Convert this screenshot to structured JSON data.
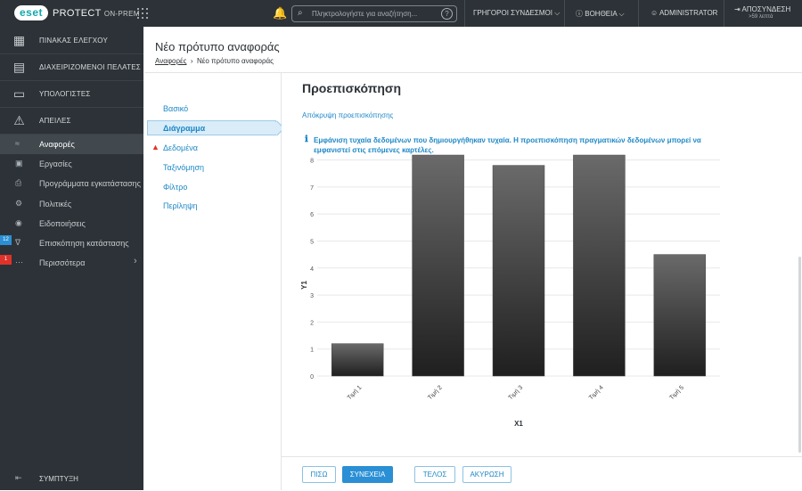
{
  "topbar": {
    "logo": "eset",
    "product": "PROTECT",
    "product_suffix": "ON-PREM",
    "search_placeholder": "Πληκτρολογήστε για αναζήτηση...",
    "quick_links": "ΓΡΗΓΟΡΟΙ ΣΥΝΔΕΣΜΟΙ",
    "help": "ΒΟΗΘΕΙΑ",
    "user": "ADMINISTRATOR",
    "logout": "ΑΠΟΣΥΝΔΕΣΗ",
    "logout_time": ">59 λεπτά"
  },
  "sidebar": {
    "main_items": [
      {
        "label": "ΠΙΝΑΚΑΣ ΕΛΕΓΧΟΥ",
        "icon": "dashboard-icon"
      },
      {
        "label": "ΔΙΑΧΕΙΡΙΖΟΜΕΝΟΙ ΠΕΛΑΤΕΣ",
        "icon": "building-icon"
      },
      {
        "label": "ΥΠΟΛΟΓΙΣΤΕΣ",
        "icon": "computer-icon"
      },
      {
        "label": "ΑΠΕΙΛΕΣ",
        "icon": "warning-icon"
      }
    ],
    "sub_items": [
      {
        "label": "Αναφορές",
        "icon": "reports-icon"
      },
      {
        "label": "Εργασίες",
        "icon": "tasks-icon"
      },
      {
        "label": "Προγράμματα εγκατάστασης",
        "icon": "installers-icon"
      },
      {
        "label": "Πολιτικές",
        "icon": "policies-icon"
      },
      {
        "label": "Ειδοποιήσεις",
        "icon": "notifications-icon"
      },
      {
        "label": "Επισκόπηση κατάστασης",
        "icon": "status-icon"
      },
      {
        "label": "Περισσότερα",
        "icon": "more-icon"
      }
    ],
    "badges": {
      "status": "12",
      "more": "1"
    },
    "collapse": "ΣΥΜΠΤΥΞΗ"
  },
  "header": {
    "title": "Νέο πρότυπο αναφοράς",
    "breadcrumb_parent": "Αναφορές",
    "breadcrumb_current": "Νέο πρότυπο αναφοράς"
  },
  "steps": [
    "Βασικό",
    "Διάγραμμα",
    "Δεδομένα",
    "Ταξινόμηση",
    "Φίλτρο",
    "Περίληψη"
  ],
  "preview": {
    "title": "Προεπισκόπηση",
    "hide_link": "Απόκρυψη προεπισκόπησης",
    "info_line1": "Εμφάνιση τυχαία δεδομένων που δημιουργήθηκαν τυχαία. Η προεπισκόπηση πραγματικών δεδομένων μπορεί να",
    "info_line2": "εμφανιστεί στις επόμενες καρτέλες."
  },
  "chart_data": {
    "type": "bar",
    "categories": [
      "Τιμή 1",
      "Τιμή 2",
      "Τιμή 3",
      "Τιμή 4",
      "Τιμή 5"
    ],
    "values": [
      1.2,
      8.3,
      7.8,
      8.8,
      4.5
    ],
    "xlabel": "X1",
    "ylabel": "Y1",
    "ylim": [
      0,
      8
    ],
    "yticks": [
      0,
      1,
      2,
      3,
      4,
      5,
      6,
      7,
      8
    ],
    "grid": true,
    "legend": "none"
  },
  "footer": {
    "back": "ΠΙΣΩ",
    "continue": "ΣΥΝΕΧΕΙΑ",
    "finish": "ΤΕΛΟΣ",
    "cancel": "ΑΚΥΡΩΣΗ"
  },
  "colors": {
    "sidebar_bg": "#2c3237",
    "accent": "#1e88c7",
    "warning": "#e0322a",
    "bar_top": "#6a6a6a",
    "bar_bottom": "#1f1f1f"
  }
}
